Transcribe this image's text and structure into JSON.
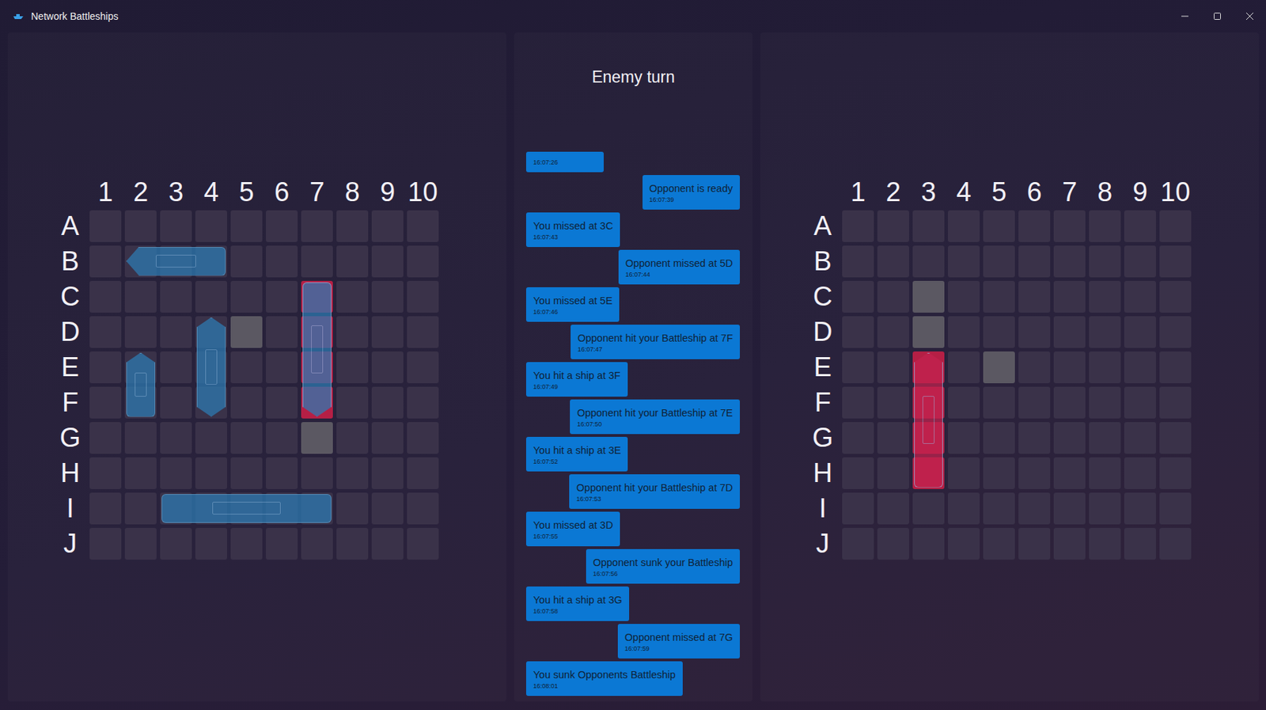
{
  "window": {
    "title": "Network Battleships"
  },
  "status": {
    "text": "Enemy turn"
  },
  "boards": [
    {
      "column_labels": [
        "1",
        "2",
        "3",
        "4",
        "5",
        "6",
        "7",
        "8",
        "9",
        "10"
      ],
      "row_labels": [
        "A",
        "B",
        "C",
        "D",
        "E",
        "F",
        "G",
        "H",
        "I",
        "J"
      ],
      "ships": [
        {
          "row": 2,
          "col": 2,
          "length": 3,
          "orientation": "horizontal",
          "bow": "start",
          "sunk": false,
          "color": "#2d7cb5"
        },
        {
          "row": 3,
          "col": 7,
          "length": 4,
          "orientation": "vertical",
          "bow": "end",
          "sunk": true,
          "color": "#2d7cb5"
        },
        {
          "row": 4,
          "col": 4,
          "length": 3,
          "orientation": "vertical",
          "bow": "both",
          "sunk": false,
          "color": "#2d7cb5"
        },
        {
          "row": 5,
          "col": 2,
          "length": 2,
          "orientation": "vertical",
          "bow": "start",
          "sunk": false,
          "color": "#2d7cb5"
        },
        {
          "row": 9,
          "col": 3,
          "length": 5,
          "orientation": "horizontal",
          "bow": "none",
          "sunk": false,
          "color": "#2d7cb5"
        }
      ],
      "shots": [
        {
          "row": 4,
          "col": 5,
          "result": "miss"
        },
        {
          "row": 7,
          "col": 7,
          "result": "miss"
        },
        {
          "row": 3,
          "col": 7,
          "result": "hit"
        },
        {
          "row": 4,
          "col": 7,
          "result": "hit"
        },
        {
          "row": 5,
          "col": 7,
          "result": "hit"
        },
        {
          "row": 6,
          "col": 7,
          "result": "hit"
        }
      ]
    },
    {
      "column_labels": [
        "1",
        "2",
        "3",
        "4",
        "5",
        "6",
        "7",
        "8",
        "9",
        "10"
      ],
      "row_labels": [
        "A",
        "B",
        "C",
        "D",
        "E",
        "F",
        "G",
        "H",
        "I",
        "J"
      ],
      "ships": [
        {
          "row": 5,
          "col": 3,
          "length": 4,
          "orientation": "vertical",
          "bow": "start",
          "sunk": true,
          "color": "#c4234f"
        }
      ],
      "shots": [
        {
          "row": 3,
          "col": 3,
          "result": "miss"
        },
        {
          "row": 4,
          "col": 3,
          "result": "miss"
        },
        {
          "row": 5,
          "col": 5,
          "result": "miss"
        },
        {
          "row": 5,
          "col": 3,
          "result": "hit"
        },
        {
          "row": 6,
          "col": 3,
          "result": "hit"
        },
        {
          "row": 7,
          "col": 3,
          "result": "hit"
        },
        {
          "row": 8,
          "col": 3,
          "result": "hit"
        }
      ]
    }
  ],
  "messages": [
    {
      "side": "you",
      "text": "",
      "time": "16:07:26"
    },
    {
      "side": "opponent",
      "text": "Opponent is ready",
      "time": "16:07:39"
    },
    {
      "side": "you",
      "text": "You missed at 3C",
      "time": "16:07:43"
    },
    {
      "side": "opponent",
      "text": "Opponent missed at 5D",
      "time": "16:07:44"
    },
    {
      "side": "you",
      "text": "You missed at 5E",
      "time": "16:07:46"
    },
    {
      "side": "opponent",
      "text": "Opponent hit your Battleship at 7F",
      "time": "16:07:47"
    },
    {
      "side": "you",
      "text": "You hit a ship at 3F",
      "time": "16:07:49"
    },
    {
      "side": "opponent",
      "text": "Opponent hit your Battleship at 7E",
      "time": "16:07:50"
    },
    {
      "side": "you",
      "text": "You hit a ship at 3E",
      "time": "16:07:52"
    },
    {
      "side": "opponent",
      "text": "Opponent hit your Battleship at 7D",
      "time": "16:07:53"
    },
    {
      "side": "you",
      "text": "You missed at 3D",
      "time": "16:07:55"
    },
    {
      "side": "opponent",
      "text": "Opponent sunk your Battleship",
      "time": "16:07:56"
    },
    {
      "side": "you",
      "text": "You hit a ship at 3G",
      "time": "16:07:58"
    },
    {
      "side": "opponent",
      "text": "Opponent missed at 7G",
      "time": "16:07:59"
    },
    {
      "side": "you",
      "text": "You sunk Opponents Battleship",
      "time": "16:08:01"
    }
  ]
}
